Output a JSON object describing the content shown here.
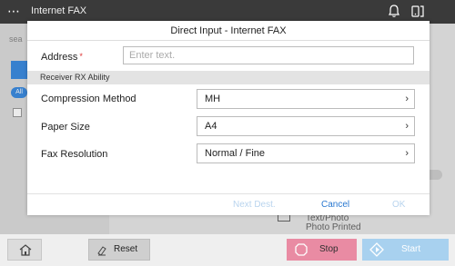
{
  "topbar": {
    "menu_icon": "⋯",
    "title": "Internet FAX",
    "icons": [
      "bell-icon",
      "phone-icon"
    ]
  },
  "background": {
    "search_hint": "sea",
    "all_label": "All",
    "mode_line1": "Text/Photo",
    "mode_line2": "Photo Printed"
  },
  "modal": {
    "title": "Direct Input - Internet FAX",
    "address_label": "Address",
    "required_mark": "*",
    "address_placeholder": "Enter text.",
    "section_label": "Receiver RX Ability",
    "rows": [
      {
        "label": "Compression Method",
        "value": "MH"
      },
      {
        "label": "Paper Size",
        "value": "A4"
      },
      {
        "label": "Fax Resolution",
        "value": "Normal / Fine"
      }
    ],
    "footer": {
      "next_dest": "Next Dest.",
      "cancel": "Cancel",
      "ok": "OK"
    }
  },
  "bottom": {
    "reset": "Reset",
    "stop": "Stop",
    "start": "Start"
  },
  "colors": {
    "accent_blue": "#2a78d0",
    "stop_pink": "#e98ba3",
    "start_blue": "#a8d1ef",
    "topbar": "#3a3a3a"
  }
}
